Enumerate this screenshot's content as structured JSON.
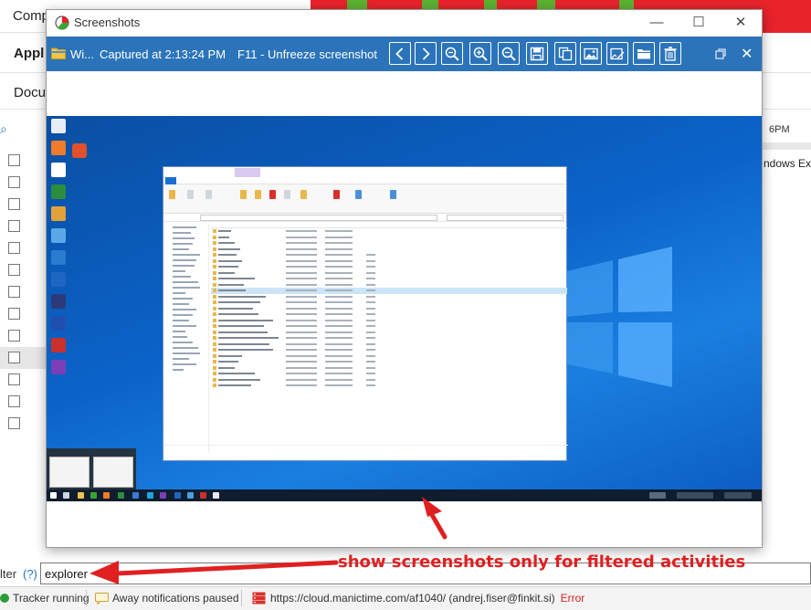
{
  "main": {
    "title_partial": "Comp",
    "app_tab_partial": "Appl",
    "doc_tab_partial": "Docu",
    "hour_label": "6PM",
    "row_text": "ndows Exp",
    "filter": {
      "label_partial": "lter",
      "help": "(?)",
      "value": "explorer"
    },
    "status": {
      "tracker": "Tracker running",
      "notifications": "Away notifications paused",
      "server": "https://cloud.manictime.com/af1040/ (andrej.fiser@finkit.si)",
      "error": "Error"
    },
    "colors": {
      "bar_red": "#e8232a",
      "bar_green": "#5bb131",
      "toolbar_blue": "#2b74b9",
      "annotation_red": "#e02020"
    }
  },
  "screenshot_window": {
    "title": "Screenshots",
    "window_controls": [
      "minimize-icon",
      "maximize-icon",
      "close-icon"
    ],
    "toolbar": {
      "app_name": "Wi...",
      "captured": "Captured at 2:13:24 PM",
      "unfreeze": "F11 - Unfreeze screenshot",
      "buttons": [
        "previous-icon",
        "next-icon",
        "zoom-fit-icon",
        "zoom-in-icon",
        "zoom-out-icon",
        "save-icon",
        "copy-icon",
        "image-icon",
        "edit-image-icon",
        "open-folder-icon",
        "delete-icon"
      ]
    }
  },
  "annotation": {
    "text": "show screenshots only for filtered activities"
  }
}
